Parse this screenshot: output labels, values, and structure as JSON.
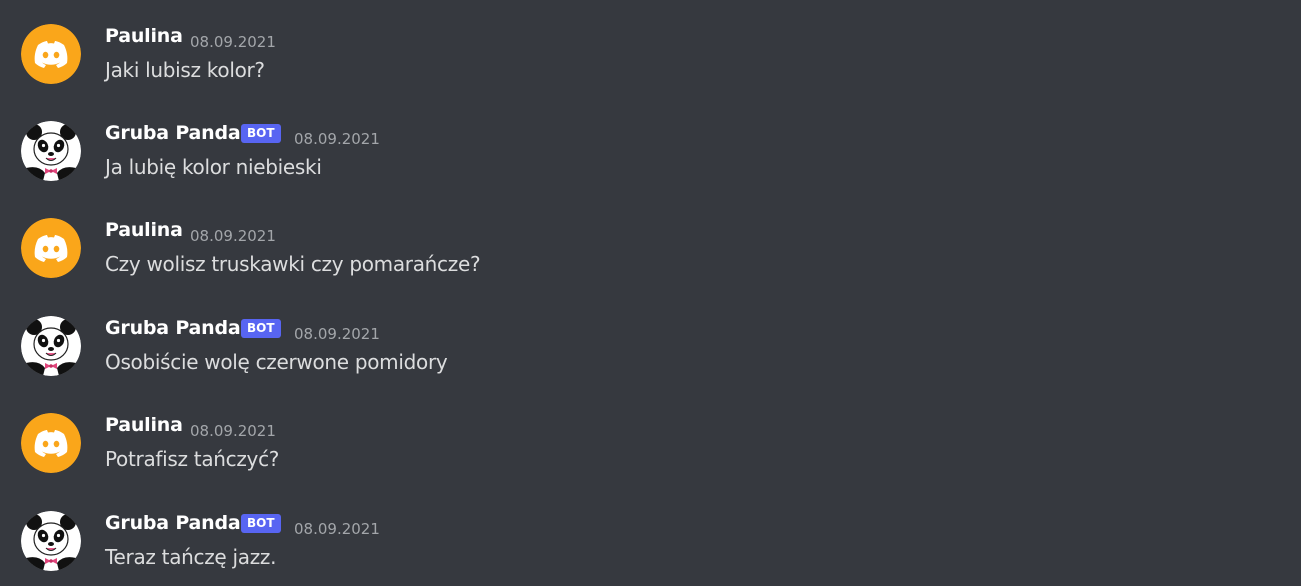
{
  "colors": {
    "background": "#36393f",
    "author_name": "#ffffff",
    "timestamp": "#a3a6aa",
    "message_text": "#dcddde",
    "bot_tag_background": "#5865f2",
    "discord_avatar_background": "#faa61a"
  },
  "messages": [
    {
      "author": "Paulina",
      "is_bot": false,
      "avatar_icon": "discord-logo-icon",
      "timestamp": "08.09.2021",
      "content": "Jaki lubisz kolor?"
    },
    {
      "author": "Gruba Panda",
      "is_bot": true,
      "bot_tag": "BOT",
      "avatar_icon": "panda-avatar-icon",
      "timestamp": "08.09.2021",
      "content": "Ja lubię kolor niebieski"
    },
    {
      "author": "Paulina",
      "is_bot": false,
      "avatar_icon": "discord-logo-icon",
      "timestamp": "08.09.2021",
      "content": "Czy wolisz truskawki czy pomarańcze?"
    },
    {
      "author": "Gruba Panda",
      "is_bot": true,
      "bot_tag": "BOT",
      "avatar_icon": "panda-avatar-icon",
      "timestamp": "08.09.2021",
      "content": "Osobiście wolę czerwone pomidory"
    },
    {
      "author": "Paulina",
      "is_bot": false,
      "avatar_icon": "discord-logo-icon",
      "timestamp": "08.09.2021",
      "content": "Potrafisz tańczyć?"
    },
    {
      "author": "Gruba Panda",
      "is_bot": true,
      "bot_tag": "BOT",
      "avatar_icon": "panda-avatar-icon",
      "timestamp": "08.09.2021",
      "content": "Teraz tańczę jazz."
    }
  ]
}
